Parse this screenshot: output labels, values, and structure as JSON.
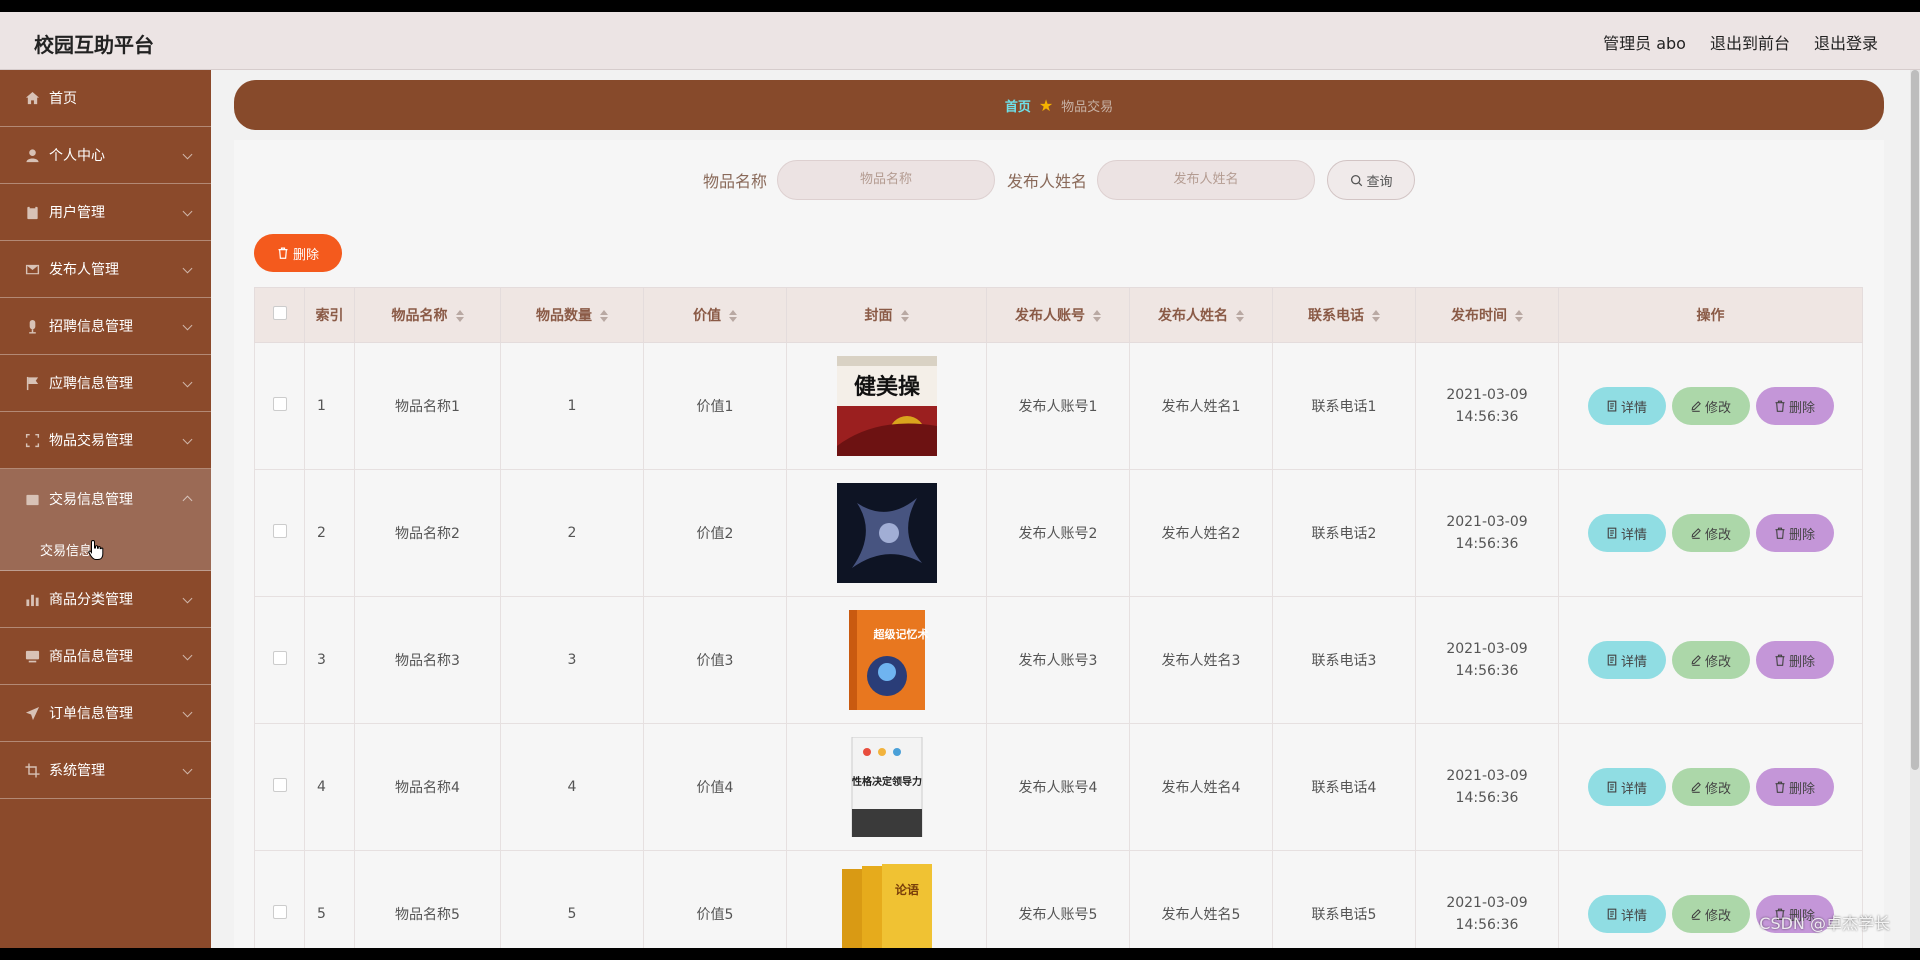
{
  "header": {
    "brand": "校园互助平台",
    "admin": "管理员 abo",
    "to_front": "退出到前台",
    "logout": "退出登录"
  },
  "sidebar": {
    "items": [
      {
        "label": "首页",
        "icon": "home-icon"
      },
      {
        "label": "个人中心",
        "icon": "user-icon"
      },
      {
        "label": "用户管理",
        "icon": "clipboard-icon"
      },
      {
        "label": "发布人管理",
        "icon": "mail-icon"
      },
      {
        "label": "招聘信息管理",
        "icon": "mic-icon"
      },
      {
        "label": "应聘信息管理",
        "icon": "flag-icon"
      },
      {
        "label": "物品交易管理",
        "icon": "frame-icon"
      },
      {
        "label": "交易信息管理",
        "icon": "box-icon"
      },
      {
        "label": "商品分类管理",
        "icon": "chart-icon"
      },
      {
        "label": "商品信息管理",
        "icon": "monitor-icon"
      },
      {
        "label": "订单信息管理",
        "icon": "send-icon"
      },
      {
        "label": "系统管理",
        "icon": "crop-icon"
      }
    ],
    "submenu": {
      "label": "交易信息"
    }
  },
  "breadcrumb": {
    "home": "首页",
    "current": "物品交易"
  },
  "search": {
    "name_label": "物品名称",
    "name_placeholder": "物品名称",
    "publisher_label": "发布人姓名",
    "publisher_placeholder": "发布人姓名",
    "query_button": "查询"
  },
  "toolbar": {
    "delete_label": "删除"
  },
  "table": {
    "columns": [
      "索引",
      "物品名称",
      "物品数量",
      "价值",
      "封面",
      "发布人账号",
      "发布人姓名",
      "联系电话",
      "发布时间",
      "操作"
    ],
    "actions": {
      "detail": "详情",
      "edit": "修改",
      "remove": "删除"
    },
    "rows": [
      {
        "index": "1",
        "name": "物品名称1",
        "qty": "1",
        "value": "价值1",
        "account": "发布人账号1",
        "publisher": "发布人姓名1",
        "phone": "联系电话1",
        "time": "2021-03-09 14:56:36"
      },
      {
        "index": "2",
        "name": "物品名称2",
        "qty": "2",
        "value": "价值2",
        "account": "发布人账号2",
        "publisher": "发布人姓名2",
        "phone": "联系电话2",
        "time": "2021-03-09 14:56:36"
      },
      {
        "index": "3",
        "name": "物品名称3",
        "qty": "3",
        "value": "价值3",
        "account": "发布人账号3",
        "publisher": "发布人姓名3",
        "phone": "联系电话3",
        "time": "2021-03-09 14:56:36"
      },
      {
        "index": "4",
        "name": "物品名称4",
        "qty": "4",
        "value": "价值4",
        "account": "发布人账号4",
        "publisher": "发布人姓名4",
        "phone": "联系电话4",
        "time": "2021-03-09 14:56:36"
      },
      {
        "index": "5",
        "name": "物品名称5",
        "qty": "5",
        "value": "价值5",
        "account": "发布人账号5",
        "publisher": "发布人姓名5",
        "phone": "联系电话5",
        "time": "2021-03-09 14:56:36"
      }
    ],
    "cover_texts": [
      "健美操",
      "",
      "超级记忆术",
      "性格决定领导力",
      "论语"
    ]
  },
  "watermark": "CSDN @卓杰学长",
  "colors": {
    "sidebar": "#8b4a2b",
    "breadcrumb": "#874a2b",
    "delete": "#f45a1d",
    "detail": "#90dde3",
    "edit": "#acd7a9",
    "remove": "#c496d8"
  }
}
